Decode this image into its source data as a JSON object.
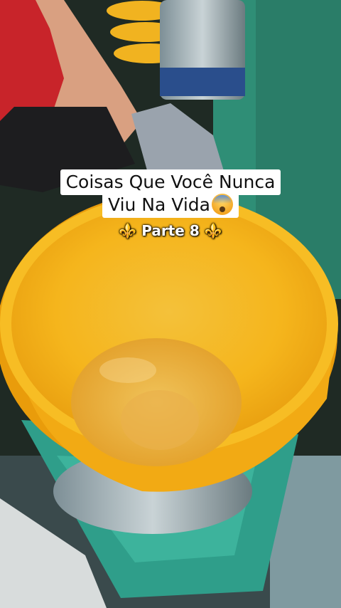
{
  "caption": {
    "line1": "Coisas Que Você Nunca",
    "line2": "Viu Na Vida",
    "emoji": "fearful-face-emoji"
  },
  "subtitle": {
    "ornament_left": "⚜️",
    "text": "Parte 8",
    "ornament_right": "⚜️"
  },
  "colors": {
    "bucket": "#f7b51a",
    "caption_bg": "#ffffff",
    "caption_text": "#111111",
    "stand": "#2f9e8a",
    "background": "#1f2a24"
  }
}
